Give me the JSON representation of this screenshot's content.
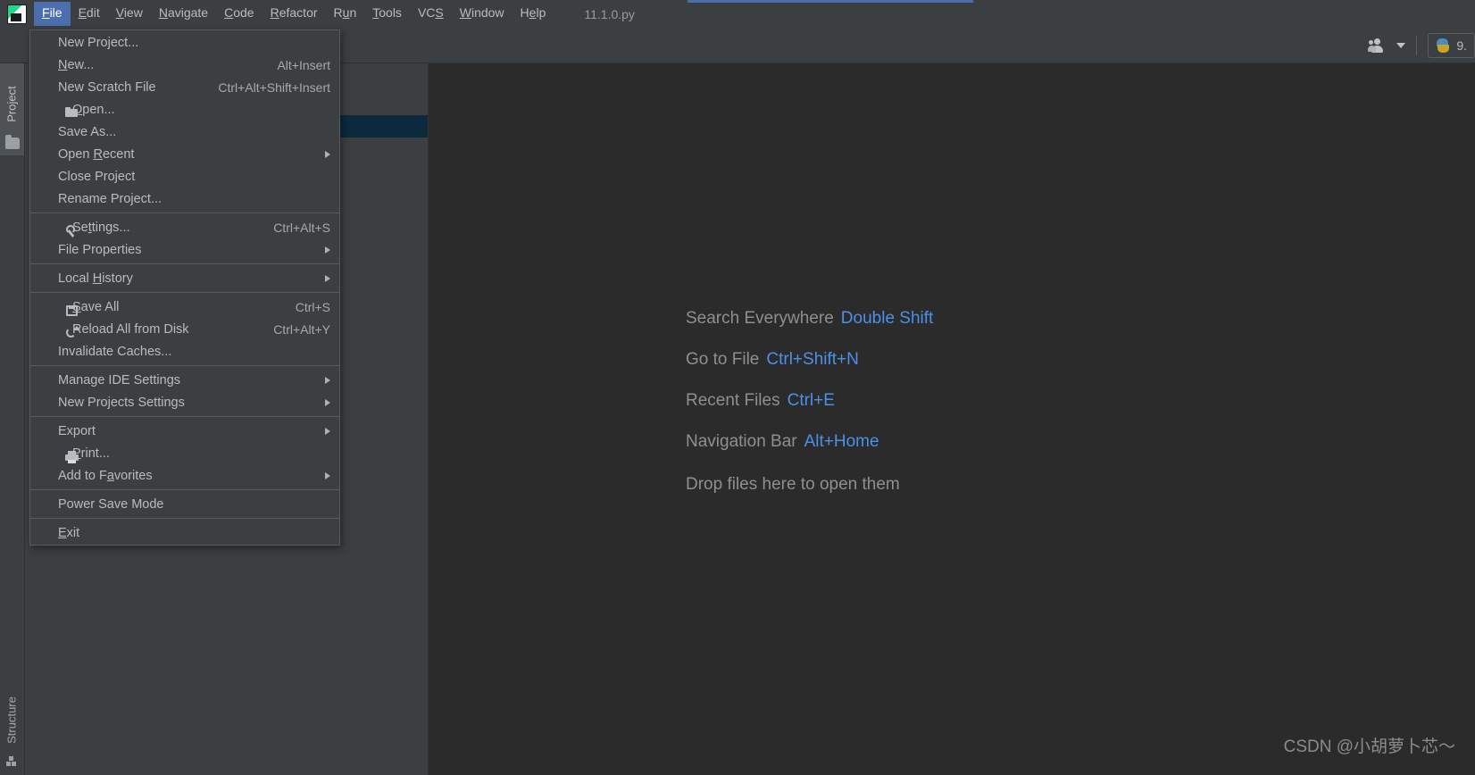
{
  "window": {
    "title": "11.1.0.py",
    "app_icon": "pycharm-logo-icon"
  },
  "menubar": {
    "items": [
      {
        "label": "File",
        "accel_index": 0,
        "active": true
      },
      {
        "label": "Edit",
        "accel_index": 0,
        "active": false
      },
      {
        "label": "View",
        "accel_index": 0,
        "active": false
      },
      {
        "label": "Navigate",
        "accel_index": 0,
        "active": false
      },
      {
        "label": "Code",
        "accel_index": 0,
        "active": false
      },
      {
        "label": "Refactor",
        "accel_index": 0,
        "active": false
      },
      {
        "label": "Run",
        "accel_index": 1,
        "active": false
      },
      {
        "label": "Tools",
        "accel_index": 0,
        "active": false
      },
      {
        "label": "VCS",
        "accel_index": 2,
        "active": false
      },
      {
        "label": "Window",
        "accel_index": 0,
        "active": false
      },
      {
        "label": "Help",
        "accel_index": 0,
        "active": false
      }
    ]
  },
  "file_menu": {
    "name": "File",
    "groups": [
      {
        "items": [
          {
            "label": "New Project...",
            "accel": "",
            "icon": "",
            "submenu": false
          },
          {
            "label": "New...",
            "accel": "Alt+Insert",
            "icon": "",
            "submenu": false,
            "mnemonic": "N"
          },
          {
            "label": "New Scratch File",
            "accel": "Ctrl+Alt+Shift+Insert",
            "icon": "",
            "submenu": false
          },
          {
            "label": "Open...",
            "accel": "",
            "icon": "open-folder-icon",
            "submenu": false,
            "mnemonic": "O"
          },
          {
            "label": "Save As...",
            "accel": "",
            "icon": "",
            "submenu": false
          },
          {
            "label": "Open Recent",
            "accel": "",
            "icon": "",
            "submenu": true,
            "mnemonic": "R"
          },
          {
            "label": "Close Project",
            "accel": "",
            "icon": "",
            "submenu": false
          },
          {
            "label": "Rename Project...",
            "accel": "",
            "icon": "",
            "submenu": false
          }
        ]
      },
      {
        "items": [
          {
            "label": "Settings...",
            "accel": "Ctrl+Alt+S",
            "icon": "wrench-icon",
            "submenu": false,
            "mnemonic": "t"
          },
          {
            "label": "File Properties",
            "accel": "",
            "icon": "",
            "submenu": true
          }
        ]
      },
      {
        "items": [
          {
            "label": "Local History",
            "accel": "",
            "icon": "",
            "submenu": true,
            "mnemonic": "H"
          }
        ]
      },
      {
        "items": [
          {
            "label": "Save All",
            "accel": "Ctrl+S",
            "icon": "save-icon",
            "submenu": false,
            "mnemonic": "S"
          },
          {
            "label": "Reload All from Disk",
            "accel": "Ctrl+Alt+Y",
            "icon": "reload-icon",
            "submenu": false
          },
          {
            "label": "Invalidate Caches...",
            "accel": "",
            "icon": "",
            "submenu": false
          }
        ]
      },
      {
        "items": [
          {
            "label": "Manage IDE Settings",
            "accel": "",
            "icon": "",
            "submenu": true
          },
          {
            "label": "New Projects Settings",
            "accel": "",
            "icon": "",
            "submenu": true
          }
        ]
      },
      {
        "items": [
          {
            "label": "Export",
            "accel": "",
            "icon": "",
            "submenu": true
          },
          {
            "label": "Print...",
            "accel": "",
            "icon": "printer-icon",
            "submenu": false,
            "mnemonic": "P"
          },
          {
            "label": "Add to Favorites",
            "accel": "",
            "icon": "",
            "submenu": true,
            "mnemonic": "a"
          }
        ]
      },
      {
        "items": [
          {
            "label": "Power Save Mode",
            "accel": "",
            "icon": "",
            "submenu": false
          }
        ]
      },
      {
        "items": [
          {
            "label": "Exit",
            "accel": "",
            "icon": "",
            "submenu": false,
            "mnemonic": "E"
          }
        ]
      }
    ]
  },
  "left_strip": {
    "project_tab_label": "Project",
    "structure_tab_label": "Structure"
  },
  "project_toolbar": {
    "collapse_all": "collapse-all-icon",
    "settings": "gear-icon",
    "hide": "minimize-icon"
  },
  "header_right": {
    "accounts_icon": "people-icon",
    "accounts_caret": "chevron-down-icon",
    "interpreter_icon": "python-icon",
    "interpreter_label": "9."
  },
  "editor_hints": {
    "rows": [
      {
        "text": "Search Everywhere",
        "key": "Double Shift"
      },
      {
        "text": "Go to File",
        "key": "Ctrl+Shift+N"
      },
      {
        "text": "Recent Files",
        "key": "Ctrl+E"
      },
      {
        "text": "Navigation Bar",
        "key": "Alt+Home"
      }
    ],
    "drop_text": "Drop files here to open them"
  },
  "watermark": {
    "text": "CSDN @小胡萝卜芯～"
  },
  "colors": {
    "accent_blue": "#4b6eaf",
    "key_blue": "#4d90e8",
    "panel_bg": "#3c3f41",
    "editor_bg": "#2b2b2b",
    "selected_row": "#0d293e"
  }
}
